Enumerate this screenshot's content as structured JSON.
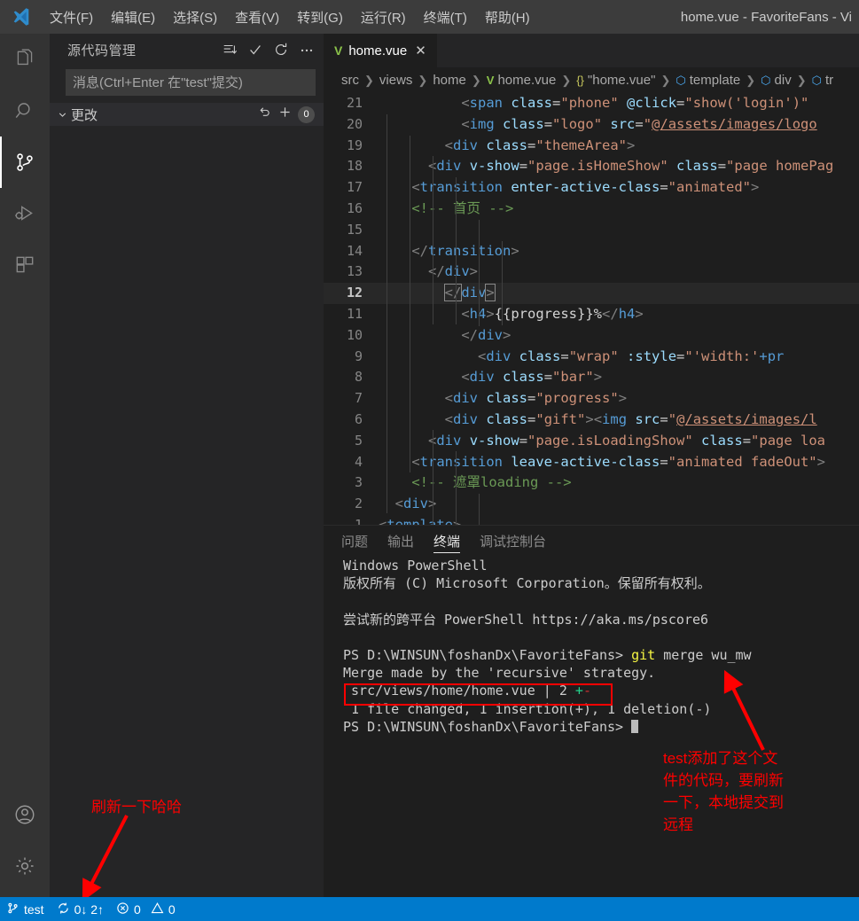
{
  "titlebar": {
    "logo": "vscode-logo-icon",
    "menus": [
      {
        "label": "文件(F)"
      },
      {
        "label": "编辑(E)"
      },
      {
        "label": "选择(S)"
      },
      {
        "label": "查看(V)"
      },
      {
        "label": "转到(G)"
      },
      {
        "label": "运行(R)"
      },
      {
        "label": "终端(T)"
      },
      {
        "label": "帮助(H)"
      }
    ],
    "window_title": "home.vue - FavoriteFans - Vi"
  },
  "activitybar": {
    "items": [
      {
        "name": "explorer",
        "icon": "files-icon",
        "active": false
      },
      {
        "name": "search",
        "icon": "search-icon",
        "active": false
      },
      {
        "name": "source-control",
        "icon": "source-control-icon",
        "active": true
      },
      {
        "name": "run-debug",
        "icon": "debug-icon",
        "active": false
      },
      {
        "name": "extensions",
        "icon": "extensions-icon",
        "active": false
      }
    ],
    "bottom": [
      {
        "name": "account",
        "icon": "account-icon"
      },
      {
        "name": "manage",
        "icon": "gear-icon"
      }
    ]
  },
  "sidebar": {
    "title": "源代码管理",
    "actions": [
      {
        "name": "view-and-sort",
        "icon": "list-icon"
      },
      {
        "name": "commit",
        "icon": "check-icon"
      },
      {
        "name": "refresh",
        "icon": "refresh-icon"
      },
      {
        "name": "more-actions",
        "icon": "ellipsis-icon"
      }
    ],
    "commit_input": {
      "value": "",
      "placeholder": "消息(Ctrl+Enter 在\"test\"提交)"
    },
    "changes_section": {
      "label": "更改",
      "count": "0",
      "actions": [
        {
          "name": "discard-all-changes",
          "icon": "undo-icon"
        },
        {
          "name": "stage-all-changes",
          "icon": "plus-icon"
        }
      ]
    }
  },
  "editor": {
    "tab": {
      "label": "home.vue",
      "icon": "vue-file-icon",
      "close": "✕"
    },
    "breadcrumbs": [
      {
        "label": "src",
        "icon": ""
      },
      {
        "label": "views",
        "icon": ""
      },
      {
        "label": "home",
        "icon": ""
      },
      {
        "label": "home.vue",
        "icon": "vue-file-icon"
      },
      {
        "label": "\"home.vue\"",
        "icon": "braces-icon"
      },
      {
        "label": "template",
        "icon": "symbol-field-icon"
      },
      {
        "label": "div",
        "icon": "symbol-field-icon"
      },
      {
        "label": "tr",
        "icon": "symbol-field-icon"
      }
    ],
    "current_line": 12,
    "lines": [
      {
        "n": 1,
        "indent": 0,
        "html": "<span class='t-punc'>&lt;</span><span class='t-tag'>template</span><span class='t-punc'>&gt;</span>"
      },
      {
        "n": 2,
        "indent": 1,
        "html": "  <span class='t-punc'>&lt;</span><span class='t-tag'>div</span><span class='t-punc'>&gt;</span>"
      },
      {
        "n": 3,
        "indent": 2,
        "html": "    <span class='t-cmt'>&lt;!-- 遮罩loading --&gt;</span>"
      },
      {
        "n": 4,
        "indent": 2,
        "html": "    <span class='t-punc'>&lt;</span><span class='t-tag'>transition</span> <span class='t-attr'>leave-active-class</span><span class='t-plain'>=</span><span class='t-str'>\"animated fadeOut\"</span><span class='t-punc'>&gt;</span>"
      },
      {
        "n": 5,
        "indent": 3,
        "html": "      <span class='t-punc'>&lt;</span><span class='t-tag'>div</span> <span class='t-attr'>v-show</span><span class='t-plain'>=</span><span class='t-str'>\"page.isLoadingShow\"</span> <span class='t-attr'>class</span><span class='t-plain'>=</span><span class='t-str'>\"page loa</span>"
      },
      {
        "n": 6,
        "indent": 4,
        "html": "        <span class='t-punc'>&lt;</span><span class='t-tag'>div</span> <span class='t-attr'>class</span><span class='t-plain'>=</span><span class='t-str'>\"gift\"</span><span class='t-punc'>&gt;&lt;</span><span class='t-tag'>img</span> <span class='t-attr'>src</span><span class='t-plain'>=</span><span class='t-str'>\"</span><span class='t-link'>@/assets/images/l</span>"
      },
      {
        "n": 7,
        "indent": 4,
        "html": "        <span class='t-punc'>&lt;</span><span class='t-tag'>div</span> <span class='t-attr'>class</span><span class='t-plain'>=</span><span class='t-str'>\"progress\"</span><span class='t-punc'>&gt;</span>"
      },
      {
        "n": 8,
        "indent": 5,
        "html": "          <span class='t-punc'>&lt;</span><span class='t-tag'>div</span> <span class='t-attr'>class</span><span class='t-plain'>=</span><span class='t-str'>\"bar\"</span><span class='t-punc'>&gt;</span>"
      },
      {
        "n": 9,
        "indent": 6,
        "html": "            <span class='t-punc'>&lt;</span><span class='t-tag'>div</span> <span class='t-attr'>class</span><span class='t-plain'>=</span><span class='t-str'>\"wrap\"</span> <span class='t-attr'>:style</span><span class='t-plain'>=</span><span class='t-str'>\"'width:'</span><span class='t-tag'>+pr</span>"
      },
      {
        "n": 10,
        "indent": 5,
        "html": "          <span class='t-punc'>&lt;/</span><span class='t-tag'>div</span><span class='t-punc'>&gt;</span>"
      },
      {
        "n": 11,
        "indent": 5,
        "html": "          <span class='t-punc'>&lt;</span><span class='t-tag'>h4</span><span class='t-punc'>&gt;</span><span class='t-txt'>{{progress}}%</span><span class='t-punc'>&lt;/</span><span class='t-tag'>h4</span><span class='t-punc'>&gt;</span>"
      },
      {
        "n": 12,
        "indent": 4,
        "html": "        <span class='t-punc bracket-box'>&lt;/</span><span class='t-tag'>div</span><span class='t-punc bracket-box'>&gt;</span>"
      },
      {
        "n": 13,
        "indent": 3,
        "html": "      <span class='t-punc'>&lt;/</span><span class='t-tag'>div</span><span class='t-punc'>&gt;</span>"
      },
      {
        "n": 14,
        "indent": 2,
        "html": "    <span class='t-punc'>&lt;/</span><span class='t-tag'>transition</span><span class='t-punc'>&gt;</span>"
      },
      {
        "n": 15,
        "indent": 0,
        "html": ""
      },
      {
        "n": 16,
        "indent": 2,
        "html": "    <span class='t-cmt'>&lt;!-- 首页 --&gt;</span>"
      },
      {
        "n": 17,
        "indent": 2,
        "html": "    <span class='t-punc'>&lt;</span><span class='t-tag'>transition</span> <span class='t-attr'>enter-active-class</span><span class='t-plain'>=</span><span class='t-str'>\"animated\"</span><span class='t-punc'>&gt;</span>"
      },
      {
        "n": 18,
        "indent": 3,
        "html": "      <span class='t-punc'>&lt;</span><span class='t-tag'>div</span> <span class='t-attr'>v-show</span><span class='t-plain'>=</span><span class='t-str'>\"page.isHomeShow\"</span> <span class='t-attr'>class</span><span class='t-plain'>=</span><span class='t-str'>\"page homePag</span>"
      },
      {
        "n": 19,
        "indent": 4,
        "html": "        <span class='t-punc'>&lt;</span><span class='t-tag'>div</span> <span class='t-attr'>class</span><span class='t-plain'>=</span><span class='t-str'>\"themeArea\"</span><span class='t-punc'>&gt;</span>"
      },
      {
        "n": 20,
        "indent": 5,
        "html": "          <span class='t-punc'>&lt;</span><span class='t-tag'>img</span> <span class='t-attr'>class</span><span class='t-plain'>=</span><span class='t-str'>\"logo\"</span> <span class='t-attr'>src</span><span class='t-plain'>=</span><span class='t-str'>\"</span><span class='t-link'>@/assets/images/logo</span>"
      },
      {
        "n": 21,
        "indent": 5,
        "html": "          <span class='t-punc'>&lt;</span><span class='t-tag'>span</span> <span class='t-attr'>class</span><span class='t-plain'>=</span><span class='t-str'>\"phone\"</span> <span class='t-attr'>@click</span><span class='t-plain'>=</span><span class='t-str'>\"show('login')\"</span>"
      }
    ]
  },
  "panel": {
    "tabs": [
      {
        "label": "问题",
        "active": false
      },
      {
        "label": "输出",
        "active": false
      },
      {
        "label": "终端",
        "active": true
      },
      {
        "label": "调试控制台",
        "active": false
      }
    ],
    "terminal_lines": [
      {
        "html": "Windows PowerShell"
      },
      {
        "html": "版权所有 (C) Microsoft Corporation。保留所有权利。"
      },
      {
        "html": ""
      },
      {
        "html": "尝试新的跨平台 PowerShell https://aka.ms/pscore6"
      },
      {
        "html": ""
      },
      {
        "html": "PS D:\\WINSUN\\foshanDx\\FavoriteFans&gt; <span class='c-yellow'>git</span> merge wu_mw"
      },
      {
        "html": "Merge made by the 'recursive' strategy."
      },
      {
        "html": " src/views/home/home.vue | 2 <span class='c-green'>+</span><span class='c-red'>-</span>"
      },
      {
        "html": " 1 file changed, 1 insertion(+), 1 deletion(-)"
      },
      {
        "html": "PS D:\\WINSUN\\foshanDx\\FavoriteFans&gt; <span class='cursor'></span>"
      }
    ]
  },
  "annotations": [
    {
      "name": "refresh-note",
      "text": "刷新一下哈哈",
      "color": "#ff0000"
    },
    {
      "name": "test-commit-note",
      "text": "test添加了这个文\n件的代码，要刷新\n一下，本地提交到\n远程",
      "color": "#ff0000"
    }
  ],
  "statusbar": {
    "branch": "test",
    "sync": "0↓ 2↑",
    "errors": "0",
    "warnings": "0",
    "background": "#007acc"
  }
}
